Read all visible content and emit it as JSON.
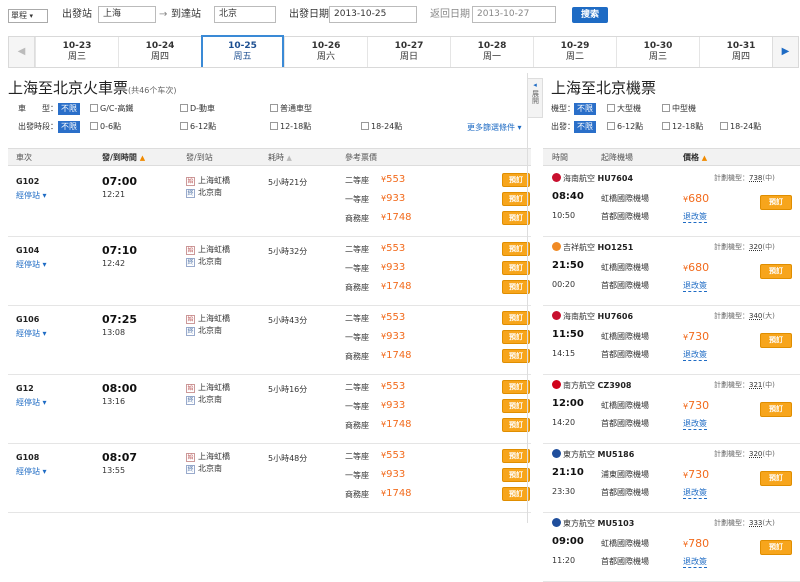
{
  "search": {
    "trip_type": "單程",
    "from_label": "出發站",
    "from_value": "上海",
    "arrow": "→",
    "to_label": "到達站",
    "to_value": "北京",
    "date_label": "出發日期",
    "date_value": "2013-10-25",
    "return_label": "返回日期",
    "return_value": "2013-10-27",
    "search_button": "搜索"
  },
  "dates": [
    {
      "date": "10-23",
      "weekday": "周三"
    },
    {
      "date": "10-24",
      "weekday": "周四"
    },
    {
      "date": "10-25",
      "weekday": "周五"
    },
    {
      "date": "10-26",
      "weekday": "周六"
    },
    {
      "date": "10-27",
      "weekday": "周日"
    },
    {
      "date": "10-28",
      "weekday": "周一"
    },
    {
      "date": "10-29",
      "weekday": "周二"
    },
    {
      "date": "10-30",
      "weekday": "周三"
    },
    {
      "date": "10-31",
      "weekday": "周四"
    }
  ],
  "train": {
    "title": "上海至北京火車票",
    "count": "(共46个车次)",
    "filter_type_label": "車　　型：",
    "filter_time_label": "出發時段：",
    "unlimited": "不限",
    "types": [
      "G/C-高鐵",
      "D-動車",
      "普通車型"
    ],
    "times": [
      "0-6點",
      "6-12點",
      "12-18點",
      "18-24點"
    ],
    "more_filters": "更多篩選條件",
    "headers": {
      "train_no": "車次",
      "dep_arr": "發/到時間",
      "stations": "發/到站",
      "duration": "耗時",
      "prices": "參考票價"
    },
    "stop_label": "經停站",
    "book": "預訂",
    "rows": [
      {
        "no": "G102",
        "dep": "07:00",
        "arr": "12:21",
        "from": "上海虹橋",
        "to": "北京南",
        "duration": "5小時21分",
        "seats": [
          {
            "name": "二等座",
            "price": "553"
          },
          {
            "name": "一等座",
            "price": "933"
          },
          {
            "name": "商務座",
            "price": "1748"
          }
        ]
      },
      {
        "no": "G104",
        "dep": "07:10",
        "arr": "12:42",
        "from": "上海虹橋",
        "to": "北京南",
        "duration": "5小時32分",
        "seats": [
          {
            "name": "二等座",
            "price": "553"
          },
          {
            "name": "一等座",
            "price": "933"
          },
          {
            "name": "商務座",
            "price": "1748"
          }
        ]
      },
      {
        "no": "G106",
        "dep": "07:25",
        "arr": "13:08",
        "from": "上海虹橋",
        "to": "北京南",
        "duration": "5小時43分",
        "seats": [
          {
            "name": "二等座",
            "price": "553"
          },
          {
            "name": "一等座",
            "price": "933"
          },
          {
            "name": "商務座",
            "price": "1748"
          }
        ]
      },
      {
        "no": "G12",
        "dep": "08:00",
        "arr": "13:16",
        "from": "上海虹橋",
        "to": "北京南",
        "duration": "5小時16分",
        "seats": [
          {
            "name": "二等座",
            "price": "553"
          },
          {
            "name": "一等座",
            "price": "933"
          },
          {
            "name": "商務座",
            "price": "1748"
          }
        ]
      },
      {
        "no": "G108",
        "dep": "08:07",
        "arr": "13:55",
        "from": "上海虹橋",
        "to": "北京南",
        "duration": "5小時48分",
        "seats": [
          {
            "name": "二等座",
            "price": "553"
          },
          {
            "name": "一等座",
            "price": "933"
          },
          {
            "name": "商務座",
            "price": "1748"
          }
        ]
      }
    ]
  },
  "flight": {
    "title": "上海至北京機票",
    "expand_tab": "展開",
    "filter_type_label": "機型：",
    "filter_time_label": "出發：",
    "unlimited": "不限",
    "types": [
      "大型機",
      "中型機"
    ],
    "times": [
      "6-12點",
      "12-18點",
      "18-24點"
    ],
    "headers": {
      "time": "時間",
      "airport": "起降機場",
      "price": "價格"
    },
    "plan_label": "計劃機型：",
    "change_label": "退改簽",
    "book": "預訂",
    "rows": [
      {
        "airline": "海南航空",
        "code": "HU7604",
        "plane": "738",
        "size": "(中)",
        "dep": "08:40",
        "arr": "10:50",
        "from_ap": "虹橋國際機場",
        "to_ap": "首都國際機場",
        "price": "680",
        "logo_color": "#c8102e"
      },
      {
        "airline": "吉祥航空",
        "code": "HO1251",
        "plane": "320",
        "size": "(中)",
        "dep": "21:50",
        "arr": "00:20",
        "from_ap": "虹橋國際機場",
        "to_ap": "首都國際機場",
        "price": "680",
        "logo_color": "#f08a24"
      },
      {
        "airline": "海南航空",
        "code": "HU7606",
        "plane": "340",
        "size": "(大)",
        "dep": "11:50",
        "arr": "14:15",
        "from_ap": "虹橋國際機場",
        "to_ap": "首都國際機場",
        "price": "730",
        "logo_color": "#c8102e"
      },
      {
        "airline": "南方航空",
        "code": "CZ3908",
        "plane": "321",
        "size": "(中)",
        "dep": "12:00",
        "arr": "14:20",
        "from_ap": "虹橋國際機場",
        "to_ap": "首都國際機場",
        "price": "730",
        "logo_color": "#d0021b"
      },
      {
        "airline": "東方航空",
        "code": "MU5186",
        "plane": "320",
        "size": "(中)",
        "dep": "21:10",
        "arr": "23:30",
        "from_ap": "浦東國際機場",
        "to_ap": "首都國際機場",
        "price": "730",
        "logo_color": "#1f4e9c"
      },
      {
        "airline": "東方航空",
        "code": "MU5103",
        "plane": "333",
        "size": "(大)",
        "dep": "09:00",
        "arr": "11:20",
        "from_ap": "虹橋國際機場",
        "to_ap": "首都國際機場",
        "price": "780",
        "logo_color": "#1f4e9c"
      }
    ]
  },
  "currency": "¥"
}
